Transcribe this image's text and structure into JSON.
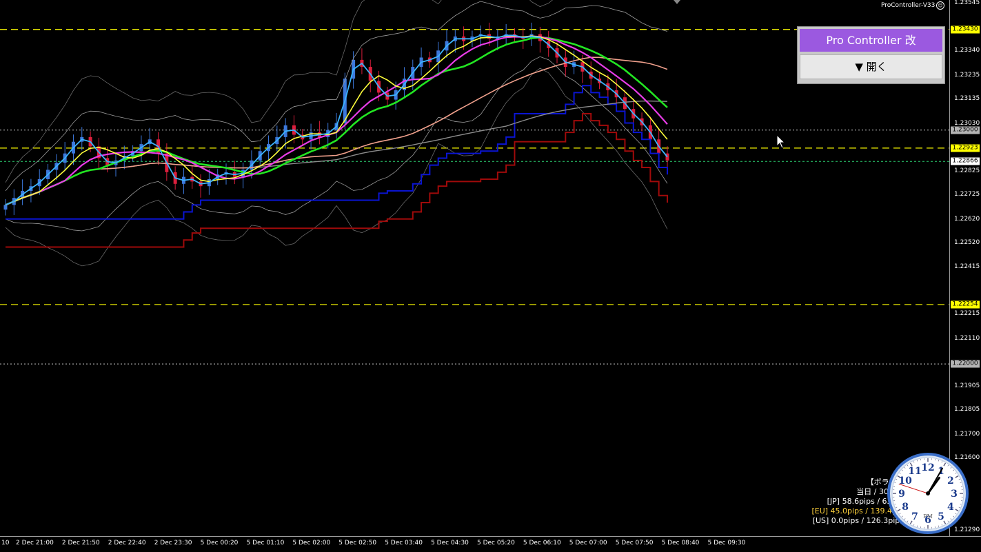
{
  "indicator_name": "ProController-V33",
  "panel": {
    "title": "Pro Controller 改",
    "open_label": "▼ 開く"
  },
  "price_axis": {
    "labels": [
      "1.23545",
      "1.23340",
      "1.23235",
      "1.23135",
      "1.23030",
      "1.22825",
      "1.22725",
      "1.22620",
      "1.22520",
      "1.22415",
      "1.22215",
      "1.22110",
      "1.21905",
      "1.21805",
      "1.21700",
      "1.21600",
      "1.21290"
    ],
    "badges": [
      {
        "text": "1.23430",
        "bg": "#ffff00",
        "fg": "#000000"
      },
      {
        "text": "1.23000",
        "bg": "#b4b4b4",
        "fg": "#000000"
      },
      {
        "text": "1.22923",
        "bg": "#ffff00",
        "fg": "#000000"
      },
      {
        "text": "1.22866",
        "bg": "#ffffff",
        "fg": "#000000"
      },
      {
        "text": "1.22254",
        "bg": "#ffff00",
        "fg": "#000000"
      },
      {
        "text": "1.22000",
        "bg": "#b4b4b4",
        "fg": "#000000"
      }
    ]
  },
  "time_axis": {
    "labels": [
      "10",
      "2 Dec 21:00",
      "2 Dec 21:50",
      "2 Dec 22:40",
      "2 Dec 23:30",
      "5 Dec 00:20",
      "5 Dec 01:10",
      "5 Dec 02:00",
      "5 Dec 02:50",
      "5 Dec 03:40",
      "5 Dec 04:30",
      "5 Dec 05:20",
      "5 Dec 06:10",
      "5 Dec 07:00",
      "5 Dec 07:50",
      "5 Dec 08:40",
      "5 Dec 09:30"
    ]
  },
  "info_panel": {
    "line1": "【ボラティ",
    "line2": "当日 / 30日平",
    "jp": "[JP] 58.6pips / 63.7p",
    "eu": "[EU] 45.0pips / 139.4pip",
    "us": "[US] 0.0pips / 126.3pips"
  },
  "clock": {
    "ampm": "PM",
    "numbers": [
      "12",
      "1",
      "2",
      "3",
      "4",
      "5",
      "6",
      "7",
      "8",
      "9",
      "10",
      "11"
    ],
    "hour": 1.2,
    "minute": 5,
    "second": 48
  },
  "colors": {
    "background": "#000000",
    "yellow_line": "#ffff00",
    "green_ma": "#22e622",
    "magenta_ma": "#e83ce8",
    "yellow_ma": "#ffff3c",
    "cyan_ma": "#3cb4ff",
    "salmon_ma": "#f0a08c",
    "gray_ma": "#8c8c8c",
    "blue_channel": "#0a14d2",
    "red_channel": "#a00a0a",
    "bull_candle": "#3c78dc",
    "bear_candle": "#dc1e3c",
    "panel_title_bg": "#9b59e0"
  },
  "chart_data": {
    "type": "candlestick",
    "y_range": [
      1.2127,
      1.2355
    ],
    "horizontal_levels": [
      1.2343,
      1.23,
      1.22923,
      1.22866,
      1.22254,
      1.22
    ],
    "approx_close_series": [
      1.2268,
      1.2271,
      1.2274,
      1.2276,
      1.2279,
      1.2283,
      1.2286,
      1.229,
      1.2295,
      1.2297,
      1.2293,
      1.2288,
      1.2285,
      1.2287,
      1.2289,
      1.2291,
      1.2294,
      1.2296,
      1.229,
      1.2282,
      1.2277,
      1.228,
      1.2278,
      1.2276,
      1.2279,
      1.2281,
      1.2282,
      1.228,
      1.2283,
      1.2287,
      1.2291,
      1.2294,
      1.2297,
      1.2302,
      1.2298,
      1.2296,
      1.2299,
      1.2297,
      1.23,
      1.2303,
      1.2322,
      1.233,
      1.2327,
      1.2321,
      1.2316,
      1.2313,
      1.2317,
      1.2322,
      1.2327,
      1.2331,
      1.2329,
      1.2334,
      1.2338,
      1.234,
      1.2338,
      1.234,
      1.2341,
      1.2339,
      1.234,
      1.2341,
      1.234,
      1.2339,
      1.2341,
      1.2338,
      1.2335,
      1.2331,
      1.2327,
      1.2329,
      1.2325,
      1.2322,
      1.232,
      1.2317,
      1.2314,
      1.2309,
      1.2305,
      1.2302,
      1.2296,
      1.229,
      1.2287
    ]
  }
}
